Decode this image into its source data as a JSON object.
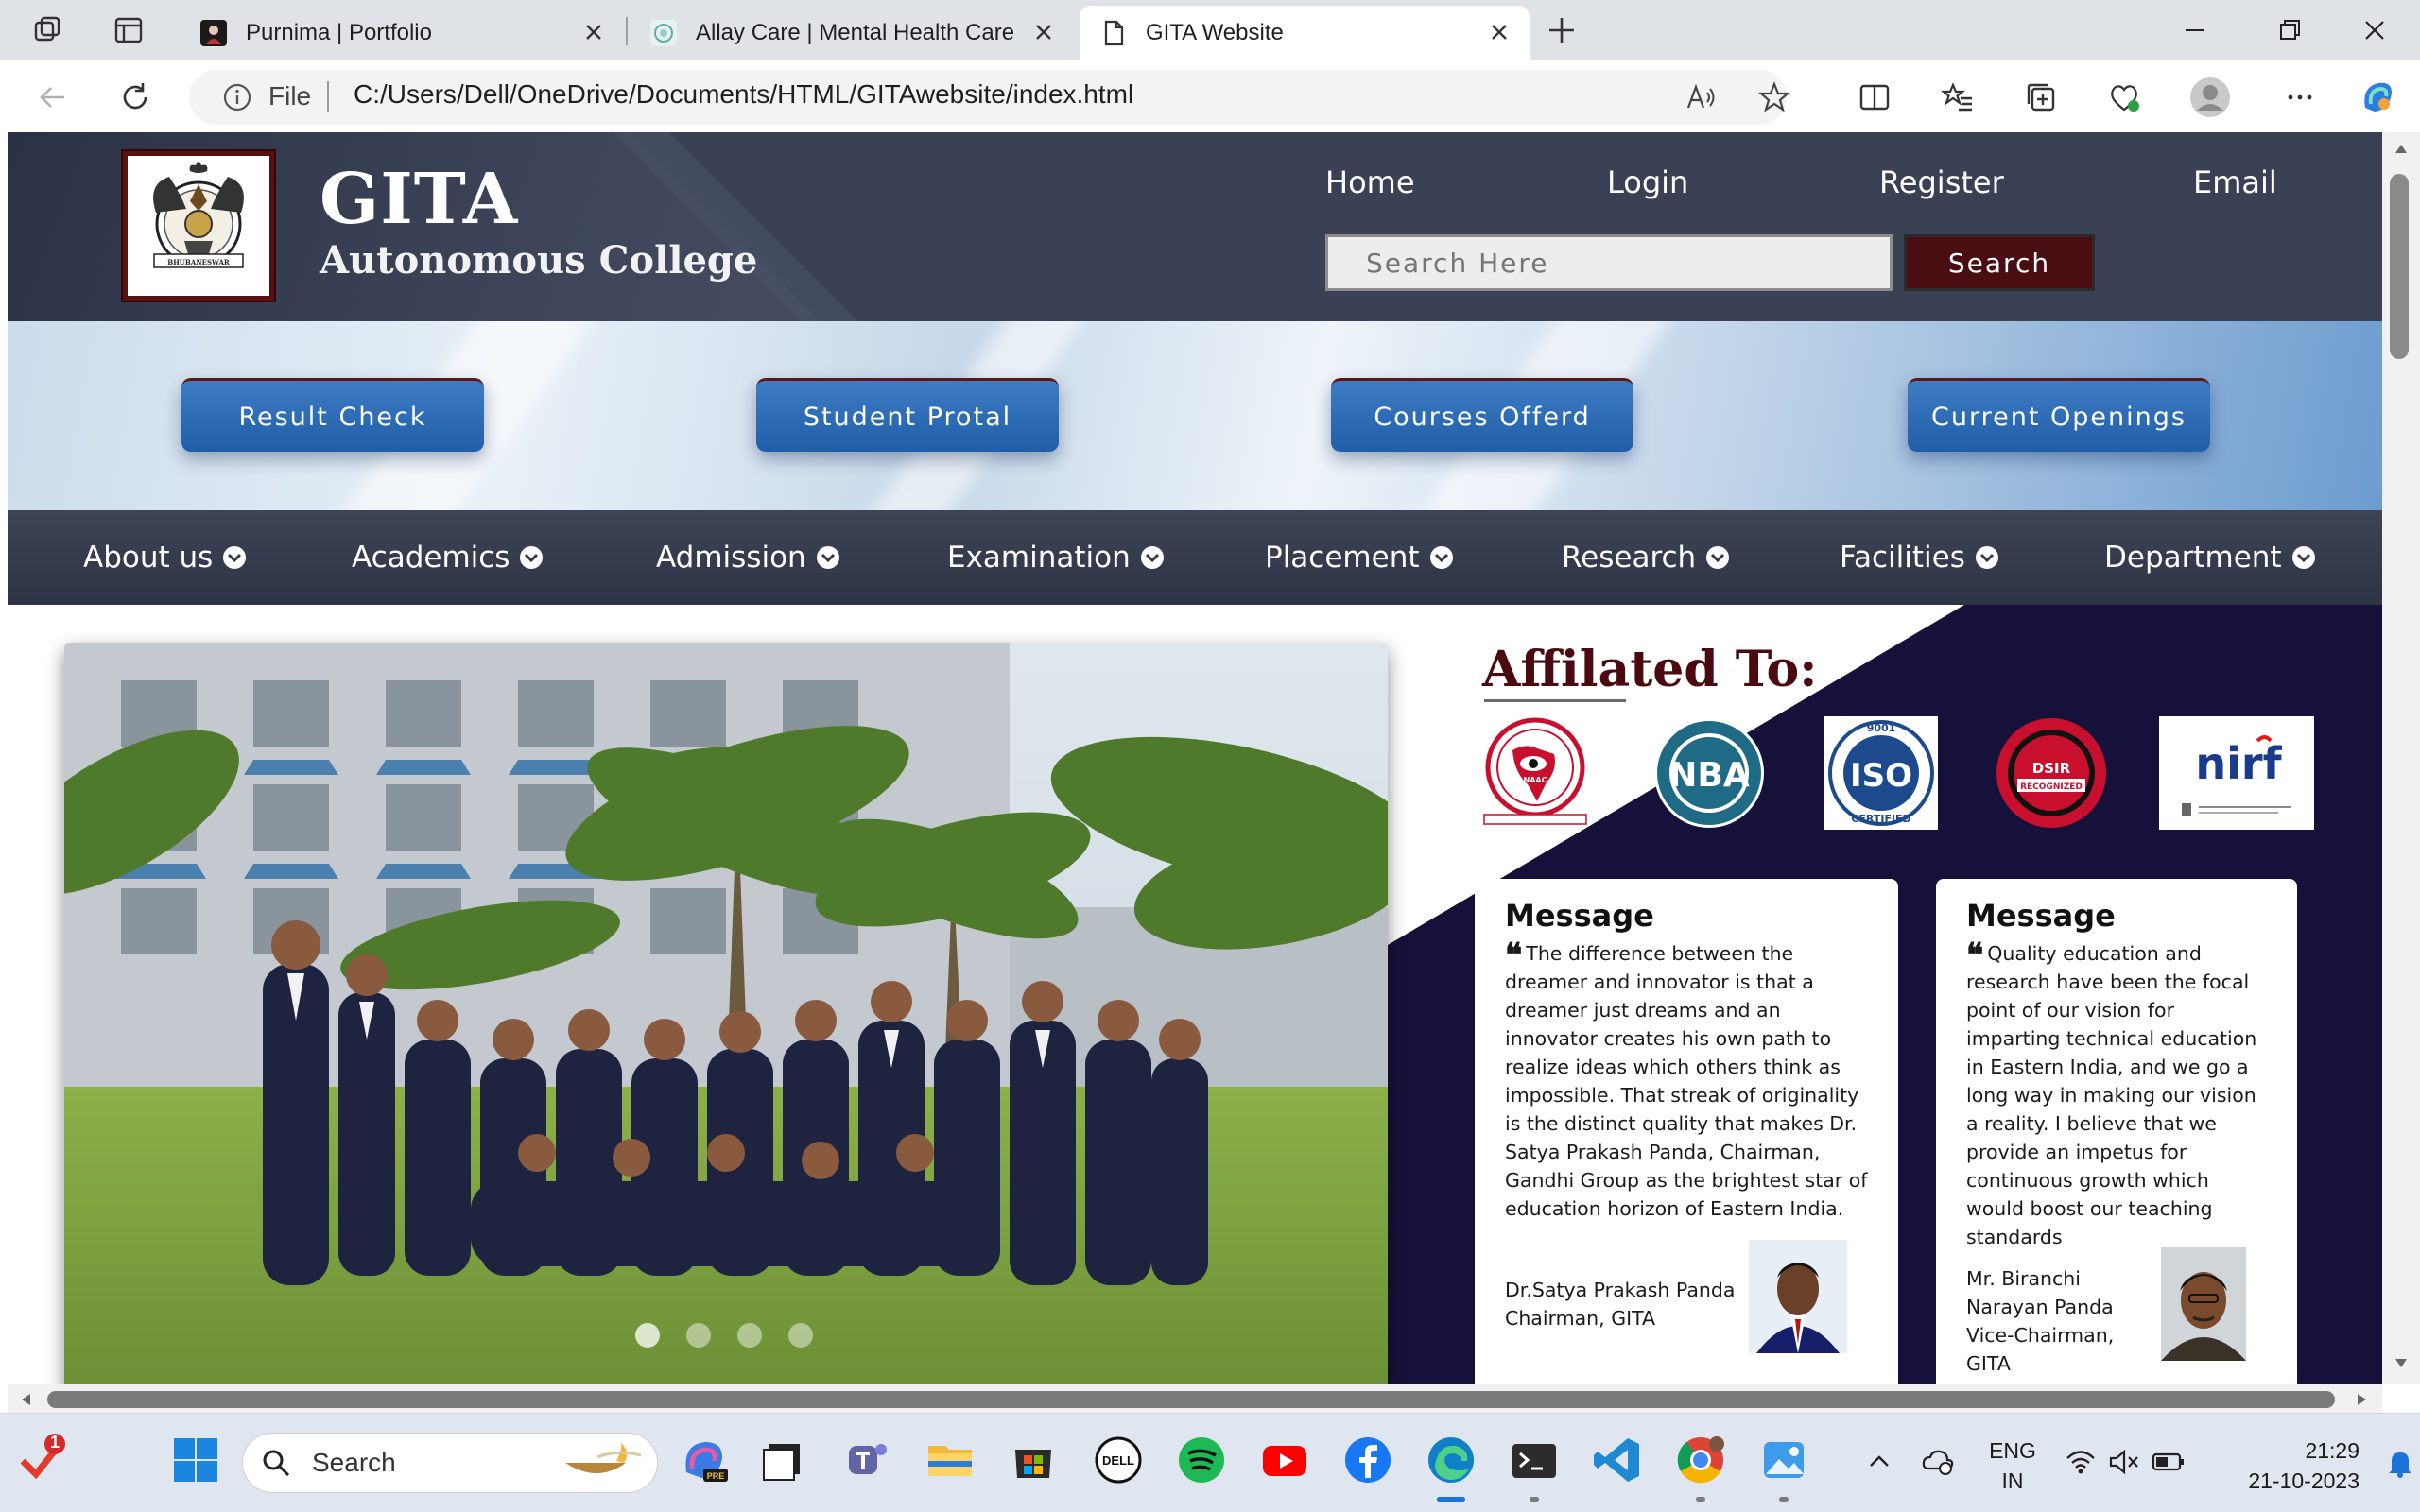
{
  "browser": {
    "tabs": [
      {
        "title": "Purnima | Portfolio"
      },
      {
        "title": "Allay Care | Mental Health Care"
      },
      {
        "title": "GITA Website"
      }
    ],
    "url_prefix": "File",
    "url": "C:/Users/Dell/OneDrive/Documents/HTML/GITAwebsite/index.html"
  },
  "header": {
    "brand_title": "GITA",
    "brand_subtitle": "Autonomous College",
    "logo_caption": "BHUBANESWAR",
    "nav": [
      "Home",
      "Login",
      "Register",
      "Email"
    ],
    "search_placeholder": "Search Here",
    "search_button": "Search"
  },
  "quick_buttons": [
    "Result Check",
    "Student Protal",
    "Courses Offerd",
    "Current Openings"
  ],
  "main_nav": [
    "About us",
    "Academics",
    "Admission",
    "Examination",
    "Placement",
    "Research",
    "Facilities",
    "Department"
  ],
  "affiliated": {
    "title": "Affilated To:",
    "logos": [
      {
        "name": "naac",
        "text": "NAAC"
      },
      {
        "name": "nba",
        "text": "NBA"
      },
      {
        "name": "iso",
        "text": "ISO",
        "top": "9001",
        "bottom": "CERTIFIED"
      },
      {
        "name": "dsir",
        "text": "DSIR",
        "sub": "RECOGNIZED"
      },
      {
        "name": "nirf",
        "text": "nirf"
      }
    ]
  },
  "messages": [
    {
      "title": "Message",
      "body": "The difference between the dreamer and innovator is that a dreamer just dreams and an innovator creates his own path to realize ideas which others think as impossible. That streak of originality is the distinct quality that makes Dr. Satya Prakash Panda, Chairman, Gandhi Group as the brightest star of education horizon of Eastern India.",
      "sign_name": "Dr.Satya Prakash Panda",
      "sign_role": "Chairman, GITA"
    },
    {
      "title": "Message",
      "body": "Quality education and research have been the focal point of our vision for imparting technical education in Eastern India, and we go a long way in making our vision a reality. I believe that we provide an impetus for continuous growth which would boost our teaching standards",
      "sign_name": "Mr. Biranchi Narayan Panda",
      "sign_role": "Vice-Chairman, GITA"
    }
  ],
  "slider": {
    "slides": 4,
    "active": 1
  },
  "taskbar": {
    "search_label": "Search",
    "notification_badge": "1",
    "lang_top": "ENG",
    "lang_bottom": "IN",
    "time": "21:29",
    "date": "21-10-2023"
  },
  "colors": {
    "header_bg": "#3a4154",
    "maroon": "#4a0d12",
    "quick_button": "#2a67b0",
    "affiliated_bg": "#15113b"
  }
}
